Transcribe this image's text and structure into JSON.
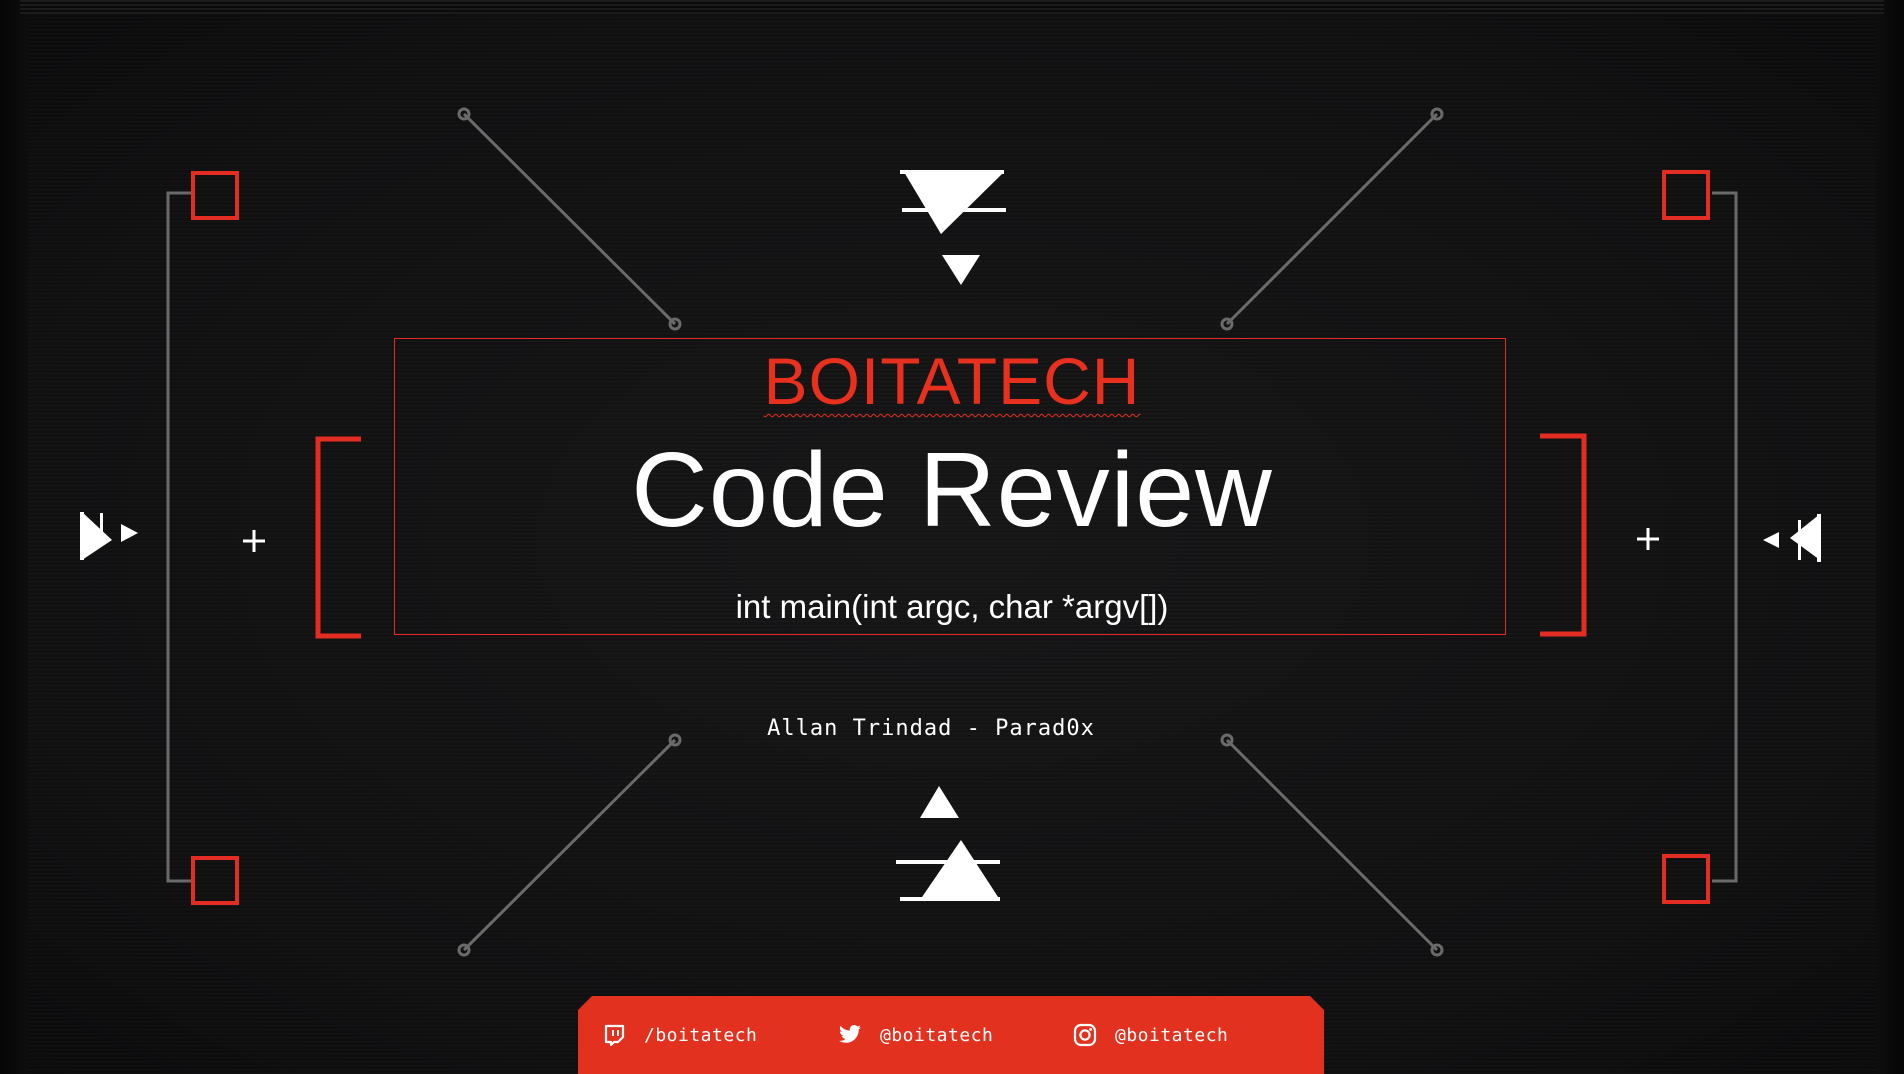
{
  "slide": {
    "brand": "BOITATECH",
    "title": "Code Review",
    "subtitle": "int main(int argc, char *argv[])",
    "author": "Allan Trindad - Parad0x"
  },
  "footer": {
    "links": [
      {
        "icon": "twitch-icon",
        "label": "/boitatech"
      },
      {
        "icon": "twitter-icon",
        "label": "@boitatech"
      },
      {
        "icon": "instagram-icon",
        "label": "@boitatech"
      }
    ]
  },
  "colors": {
    "background": "#111112",
    "accent": "#e32c22",
    "text": "#ffffff",
    "line": "#6a6a6a"
  }
}
